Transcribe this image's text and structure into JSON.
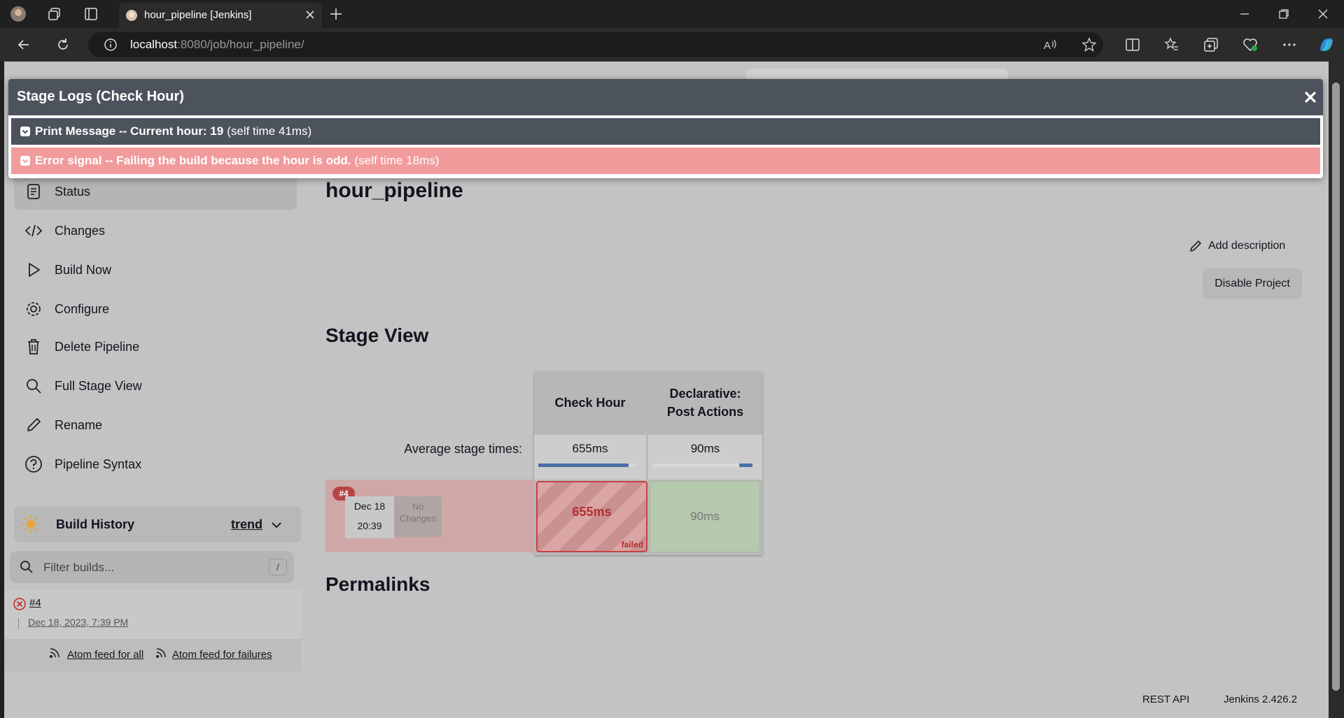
{
  "browser": {
    "tab_title": "hour_pipeline [Jenkins]",
    "url_host": "localhost",
    "url_rest": ":8080/job/hour_pipeline/"
  },
  "sidebar": {
    "items": [
      {
        "label": "Status",
        "icon": "document-icon"
      },
      {
        "label": "Changes",
        "icon": "code-icon"
      },
      {
        "label": "Build Now",
        "icon": "play-icon"
      },
      {
        "label": "Configure",
        "icon": "gear-icon"
      },
      {
        "label": "Delete Pipeline",
        "icon": "trash-icon"
      },
      {
        "label": "Full Stage View",
        "icon": "search-icon"
      },
      {
        "label": "Rename",
        "icon": "pencil-icon"
      },
      {
        "label": "Pipeline Syntax",
        "icon": "help-icon"
      }
    ],
    "build_history": {
      "title": "Build History",
      "trend": "trend"
    },
    "filter_placeholder": "Filter builds...",
    "filter_shortcut": "/",
    "builds": [
      {
        "number": "#4",
        "date": "Dec 18, 2023, 7:39 PM",
        "status": "failed"
      }
    ],
    "feeds": {
      "all": "Atom feed for all",
      "failures": "Atom feed for failures"
    }
  },
  "main": {
    "title": "hour_pipeline",
    "add_description": "Add description",
    "disable_project": "Disable Project",
    "stage_view_title": "Stage View",
    "permalinks_title": "Permalinks"
  },
  "stage_view": {
    "avg_label": "Average stage times:",
    "stages": [
      {
        "name": "Check Hour",
        "avg": "655ms",
        "avg_fraction": 0.92
      },
      {
        "name_line1": "Declarative:",
        "name_line2": "Post Actions",
        "avg": "90ms",
        "avg_fraction": 0.13
      }
    ],
    "build": {
      "badge": "#4",
      "date": "Dec 18",
      "time": "20:39",
      "changes_line1": "No",
      "changes_line2": "Changes",
      "cells": [
        {
          "value": "655ms",
          "status": "failed"
        },
        {
          "value": "90ms",
          "status": "success"
        }
      ]
    }
  },
  "modal": {
    "title": "Stage Logs (Check Hour)",
    "logs": [
      {
        "text": "Print Message -- Current hour: 19",
        "self_time": "(self time 41ms)",
        "color": "#4c535d"
      },
      {
        "text": "Error signal -- Failing the build because the hour is odd.",
        "self_time": "(self time 18ms)",
        "color": "#f19b9d"
      }
    ]
  },
  "footer": {
    "rest_api": "REST API",
    "version": "Jenkins 2.426.2"
  }
}
